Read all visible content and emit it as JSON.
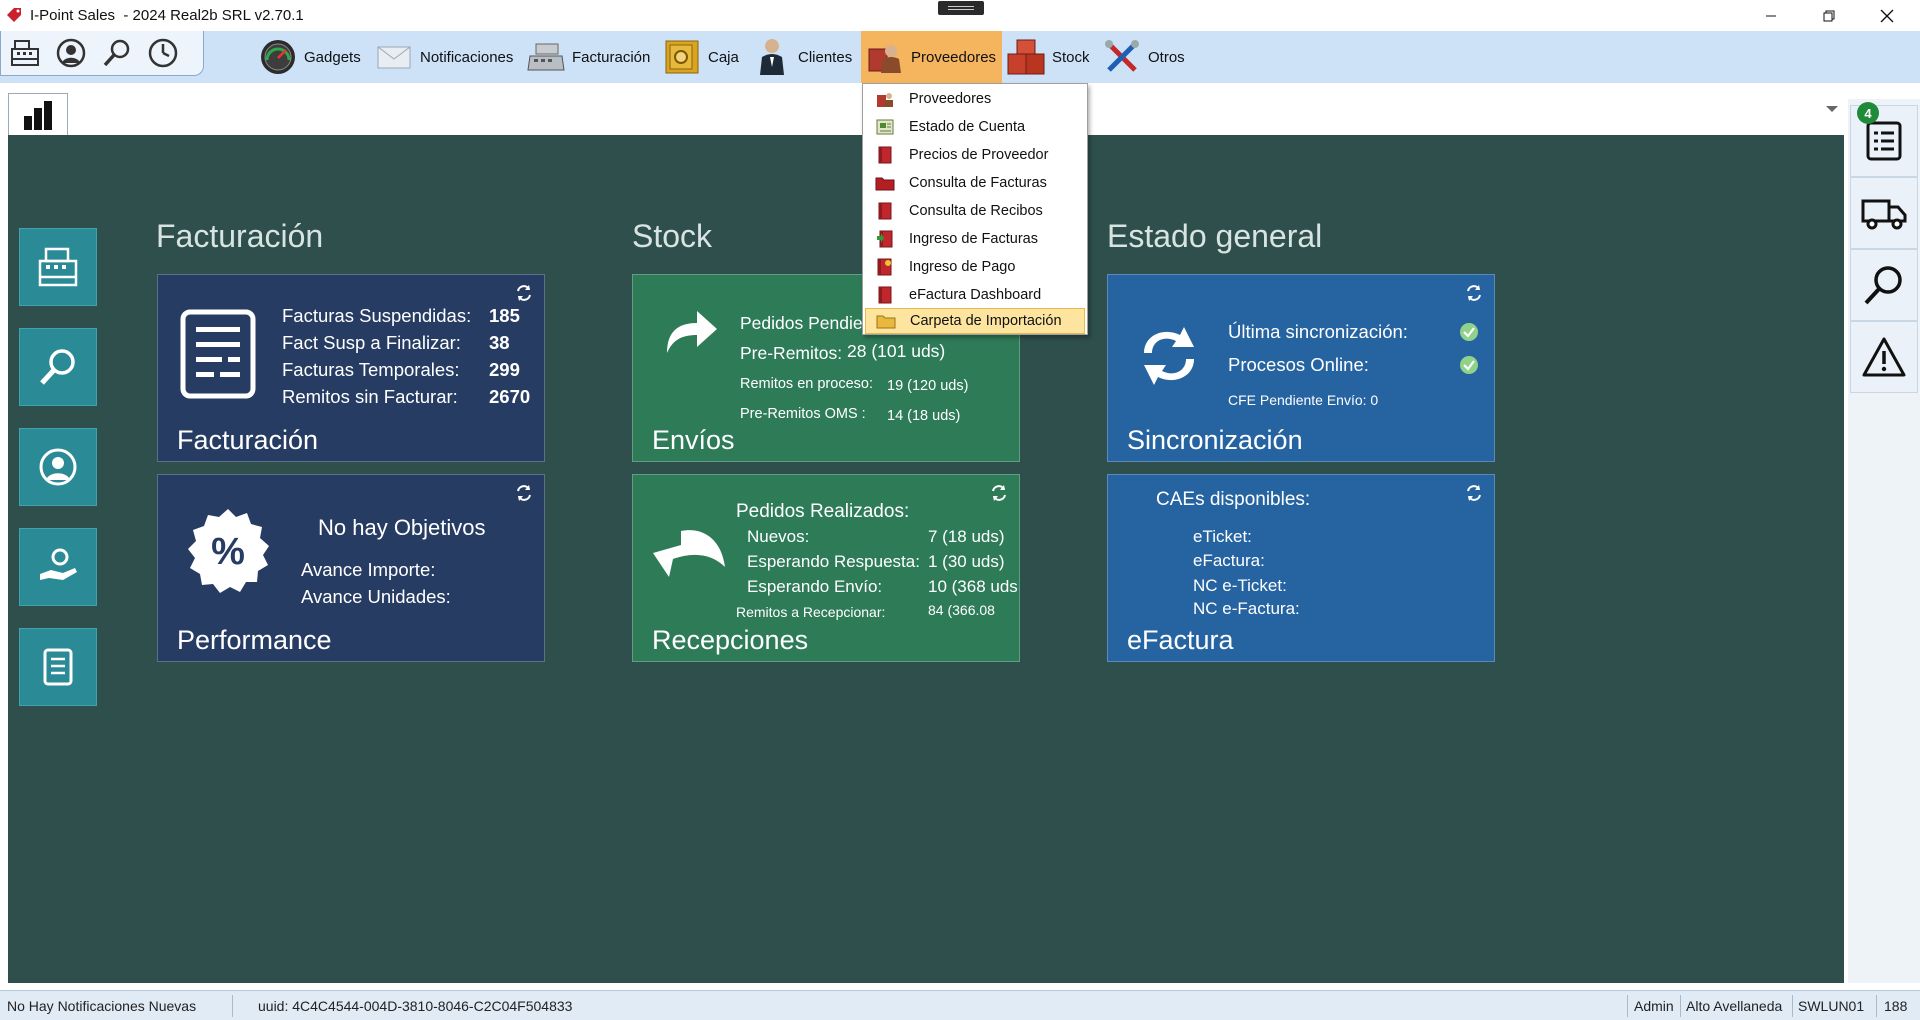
{
  "window": {
    "title": "I-Point Sales  - 2024 Real2b SRL v2.70.1",
    "brand_color": "#cc1f2d"
  },
  "quickbar": {
    "items": [
      "register-icon",
      "user-support-icon",
      "search-icon",
      "clock-icon"
    ]
  },
  "menu": {
    "items": [
      {
        "label": "Gadgets",
        "icon": "gauge-icon"
      },
      {
        "label": "Notificaciones",
        "icon": "envelope-icon"
      },
      {
        "label": "Facturación",
        "icon": "cash-register-icon"
      },
      {
        "label": "Caja",
        "icon": "safe-icon"
      },
      {
        "label": "Clientes",
        "icon": "person-icon"
      },
      {
        "label": "Proveedores",
        "icon": "supplier-icon",
        "active": true
      },
      {
        "label": "Stock",
        "icon": "boxes-icon"
      },
      {
        "label": "Otros",
        "icon": "tools-icon"
      }
    ],
    "active_color": "#f5b45e"
  },
  "dropdown": {
    "items": [
      {
        "label": "Proveedores",
        "icon": "supplier-icon"
      },
      {
        "label": "Estado de Cuenta",
        "icon": "account-statement-icon"
      },
      {
        "label": "Precios de Proveedor",
        "icon": "book-icon"
      },
      {
        "label": "Consulta de Facturas",
        "icon": "folder-red-icon"
      },
      {
        "label": "Consulta de Recibos",
        "icon": "book-icon"
      },
      {
        "label": "Ingreso de Facturas",
        "icon": "book-add-icon"
      },
      {
        "label": "Ingreso de Pago",
        "icon": "book-payment-icon"
      },
      {
        "label": "eFactura Dashboard",
        "icon": "book-icon"
      },
      {
        "label": "Carpeta de Importación",
        "icon": "folder-yellow-icon",
        "selected": true
      }
    ]
  },
  "dashboard": {
    "sections": {
      "facturacion": "Facturación",
      "stock": "Stock",
      "estado": "Estado general"
    },
    "facturacion_card": {
      "title": "Facturación",
      "rows": [
        {
          "label": "Facturas Suspendidas:",
          "value": "185"
        },
        {
          "label": "Fact Susp a Finalizar:",
          "value": "38"
        },
        {
          "label": "Facturas Temporales:",
          "value": "299"
        },
        {
          "label": "Remitos sin Facturar:",
          "value": "2670"
        }
      ]
    },
    "performance_card": {
      "title": "Performance",
      "heading": "No hay Objetivos",
      "line1": "Avance Importe:",
      "line2": "Avance Unidades:"
    },
    "envios_card": {
      "title": "Envíos",
      "pedidos": "Pedidos Pendier",
      "preremitos_label": "Pre-Remitos:",
      "preremitos_value": "28 (101 uds)",
      "remitos_label": "Remitos en proceso:",
      "remitos_value": "19 (120 uds)",
      "oms_label": "Pre-Remitos OMS :",
      "oms_value": "14 (18 uds)"
    },
    "recepciones_card": {
      "title": "Recepciones",
      "heading": "Pedidos Realizados:",
      "rows": [
        {
          "label": "Nuevos:",
          "value": "7 (18 uds)"
        },
        {
          "label": "Esperando Respuesta:",
          "value": "1 (30 uds)"
        },
        {
          "label": "Esperando Envío:",
          "value": "10 (368 uds"
        }
      ],
      "remitos_label": "Remitos a Recepcionar:",
      "remitos_value": "84 (366.08"
    },
    "sync_card": {
      "title": "Sincronización",
      "line1": "Última sincronización:",
      "line2": "Procesos Online:",
      "line3": "CFE Pendiente Envío: 0"
    },
    "efactura_card": {
      "title": "eFactura",
      "heading": "CAEs disponibles:",
      "rows": [
        "eTicket:",
        "eFactura:",
        "NC e-Ticket:",
        "NC e-Factura:"
      ]
    },
    "colors": {
      "background": "#2f4f4c",
      "navy": "#273c63",
      "green": "#2e7b58",
      "blue": "#2563a1",
      "sidebar": "#2a8a95"
    }
  },
  "right_panel": {
    "badge": "4",
    "items": [
      "task-list-icon",
      "truck-icon",
      "search-icon",
      "warning-icon"
    ]
  },
  "statusbar": {
    "notifications": "No Hay Notificaciones Nuevas",
    "uuid": "uuid: 4C4C4544-004D-3810-8046-C2C04F504833",
    "user": "Admin",
    "branch": "Alto Avellaneda",
    "terminal": "SWLUN01",
    "number": "188"
  }
}
